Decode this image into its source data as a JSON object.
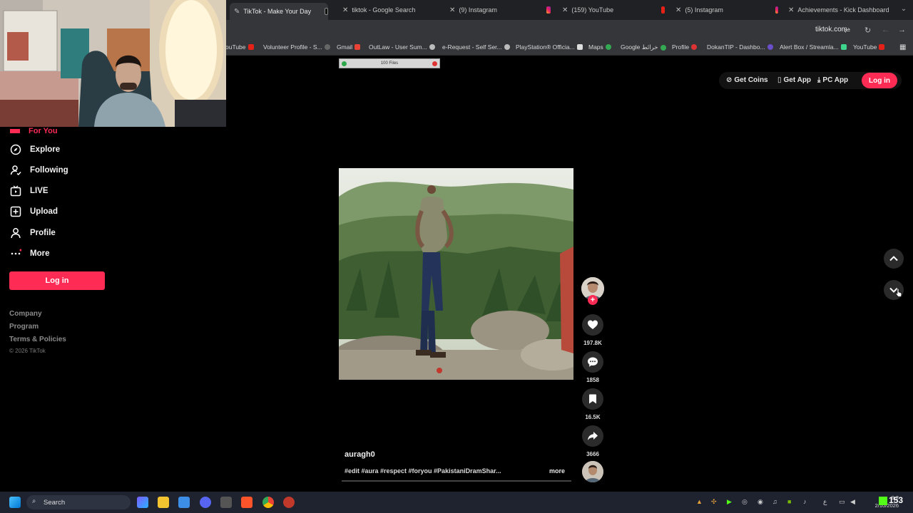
{
  "browser": {
    "tabs": [
      {
        "title": "TikTok - Make Your Day",
        "icon": "tiktok-icon",
        "active": true
      },
      {
        "title": "tiktok - Google Search",
        "icon": "google-icon",
        "active": false
      },
      {
        "title": "(9) Instagram",
        "icon": "instagram-icon",
        "active": false
      },
      {
        "title": "(159) YouTube",
        "icon": "youtube-icon",
        "active": false
      },
      {
        "title": "(5) Instagram",
        "icon": "instagram-icon",
        "active": false
      },
      {
        "title": "Achievements - Kick Dashboard",
        "icon": "kick-icon",
        "active": false
      }
    ],
    "url": "tiktok.com",
    "bookmarks": [
      "ouTube",
      "Volunteer Profile - S...",
      "Gmail",
      "OutLaw - User Sum...",
      "e-Request - Self Ser...",
      "PlayStation® Officia...",
      "Maps",
      "Google خرائط",
      "Profile",
      "DokanTIP - Dashbo...",
      "Alert Box / Streamla...",
      "YouTube"
    ]
  },
  "overlay_bar": {
    "label": "100 Files"
  },
  "sidebar": {
    "for_you": "For You",
    "items": [
      {
        "label": "Explore",
        "icon": "compass-icon"
      },
      {
        "label": "Following",
        "icon": "following-icon"
      },
      {
        "label": "LIVE",
        "icon": "live-icon"
      },
      {
        "label": "Upload",
        "icon": "upload-icon"
      },
      {
        "label": "Profile",
        "icon": "profile-icon"
      },
      {
        "label": "More",
        "icon": "more-icon"
      }
    ],
    "login_label": "Log in",
    "footer": [
      "Company",
      "Program",
      "Terms & Policies"
    ],
    "copyright": "© 2026 TikTok"
  },
  "header": {
    "get_coins": "Get Coins",
    "get_app": "Get App",
    "pc_app": "PC App",
    "login": "Log in"
  },
  "video": {
    "username": "auragh0",
    "caption": "#edit #aura #respect #foryou #PakistaniDramShar...",
    "more": "more",
    "likes": "197.8K",
    "comments": "1858",
    "saves": "16.5K",
    "shares": "3666"
  },
  "taskbar": {
    "search": "Search",
    "time": "9:2",
    "date": "2/10/2026",
    "kick_count": "153",
    "lang": "ع"
  },
  "colors": {
    "tiktok_red": "#fe2c55",
    "background": "#000000"
  }
}
